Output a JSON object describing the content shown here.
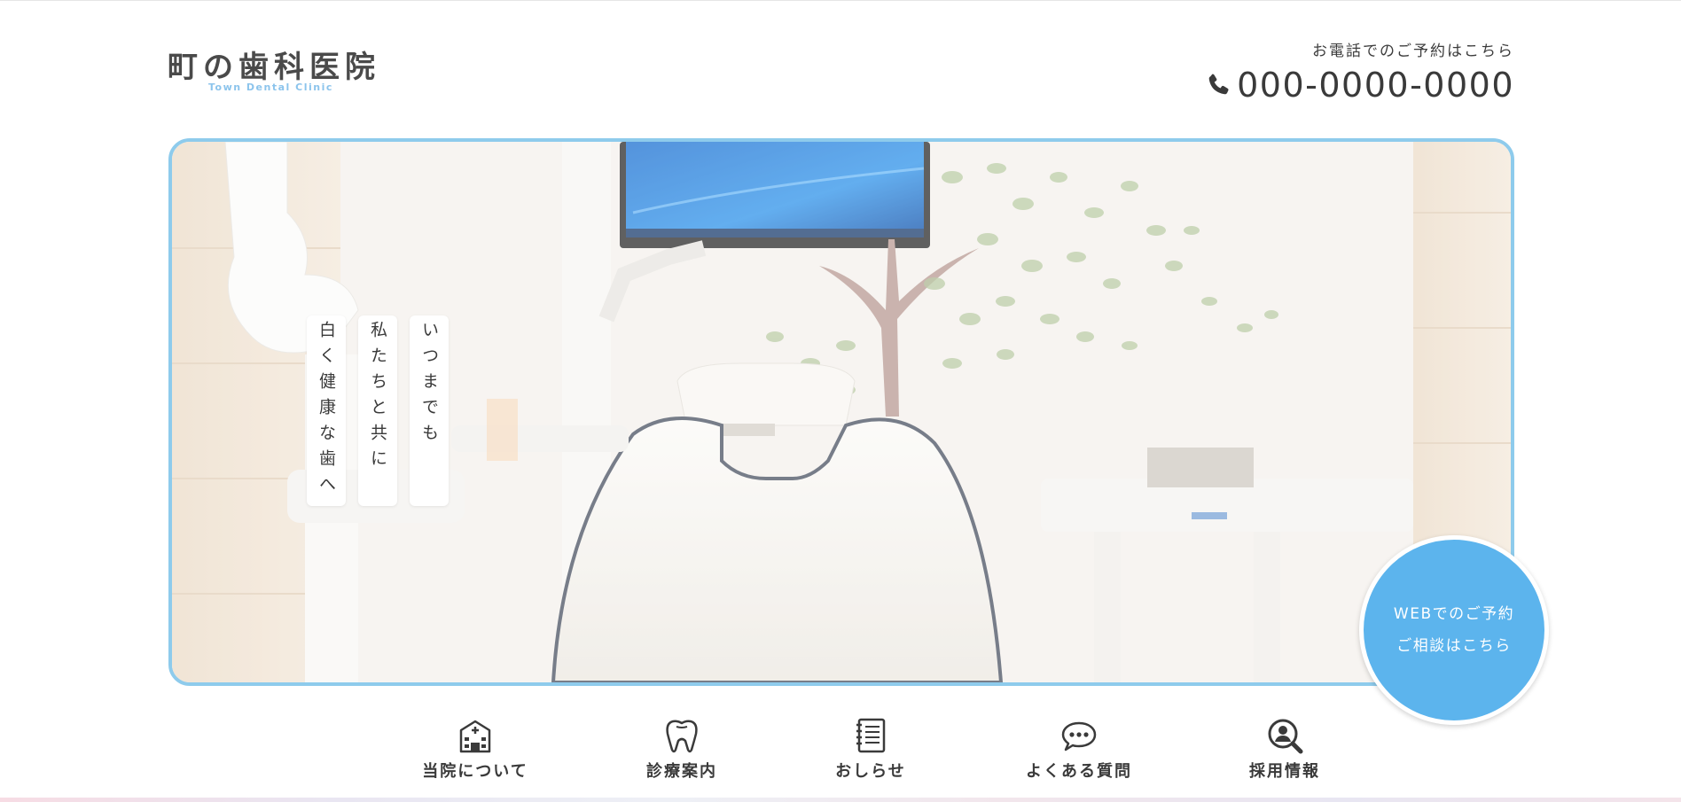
{
  "header": {
    "logo_name": "町の歯科医院",
    "logo_sub": "Town Dental Clinic",
    "contact_caption": "お電話でのご予約はこちら",
    "phone": "000-0000-0000"
  },
  "hero": {
    "tagline": [
      "いつまでも",
      "私たちと共に",
      "白く健康な歯へ"
    ],
    "web_button": {
      "line1": "WEBでのご予約",
      "line2": "ご相談はこちら"
    }
  },
  "nav": {
    "items": [
      {
        "label": "当院について",
        "icon": "clinic-building-icon"
      },
      {
        "label": "診療案内",
        "icon": "tooth-icon"
      },
      {
        "label": "おしらせ",
        "icon": "notebook-icon"
      },
      {
        "label": "よくある質問",
        "icon": "chat-bubble-icon"
      },
      {
        "label": "採用情報",
        "icon": "search-person-icon"
      }
    ]
  },
  "colors": {
    "accent": "#5cb4ed",
    "hero_border": "#8ecbec",
    "text": "#3a3a3a"
  }
}
